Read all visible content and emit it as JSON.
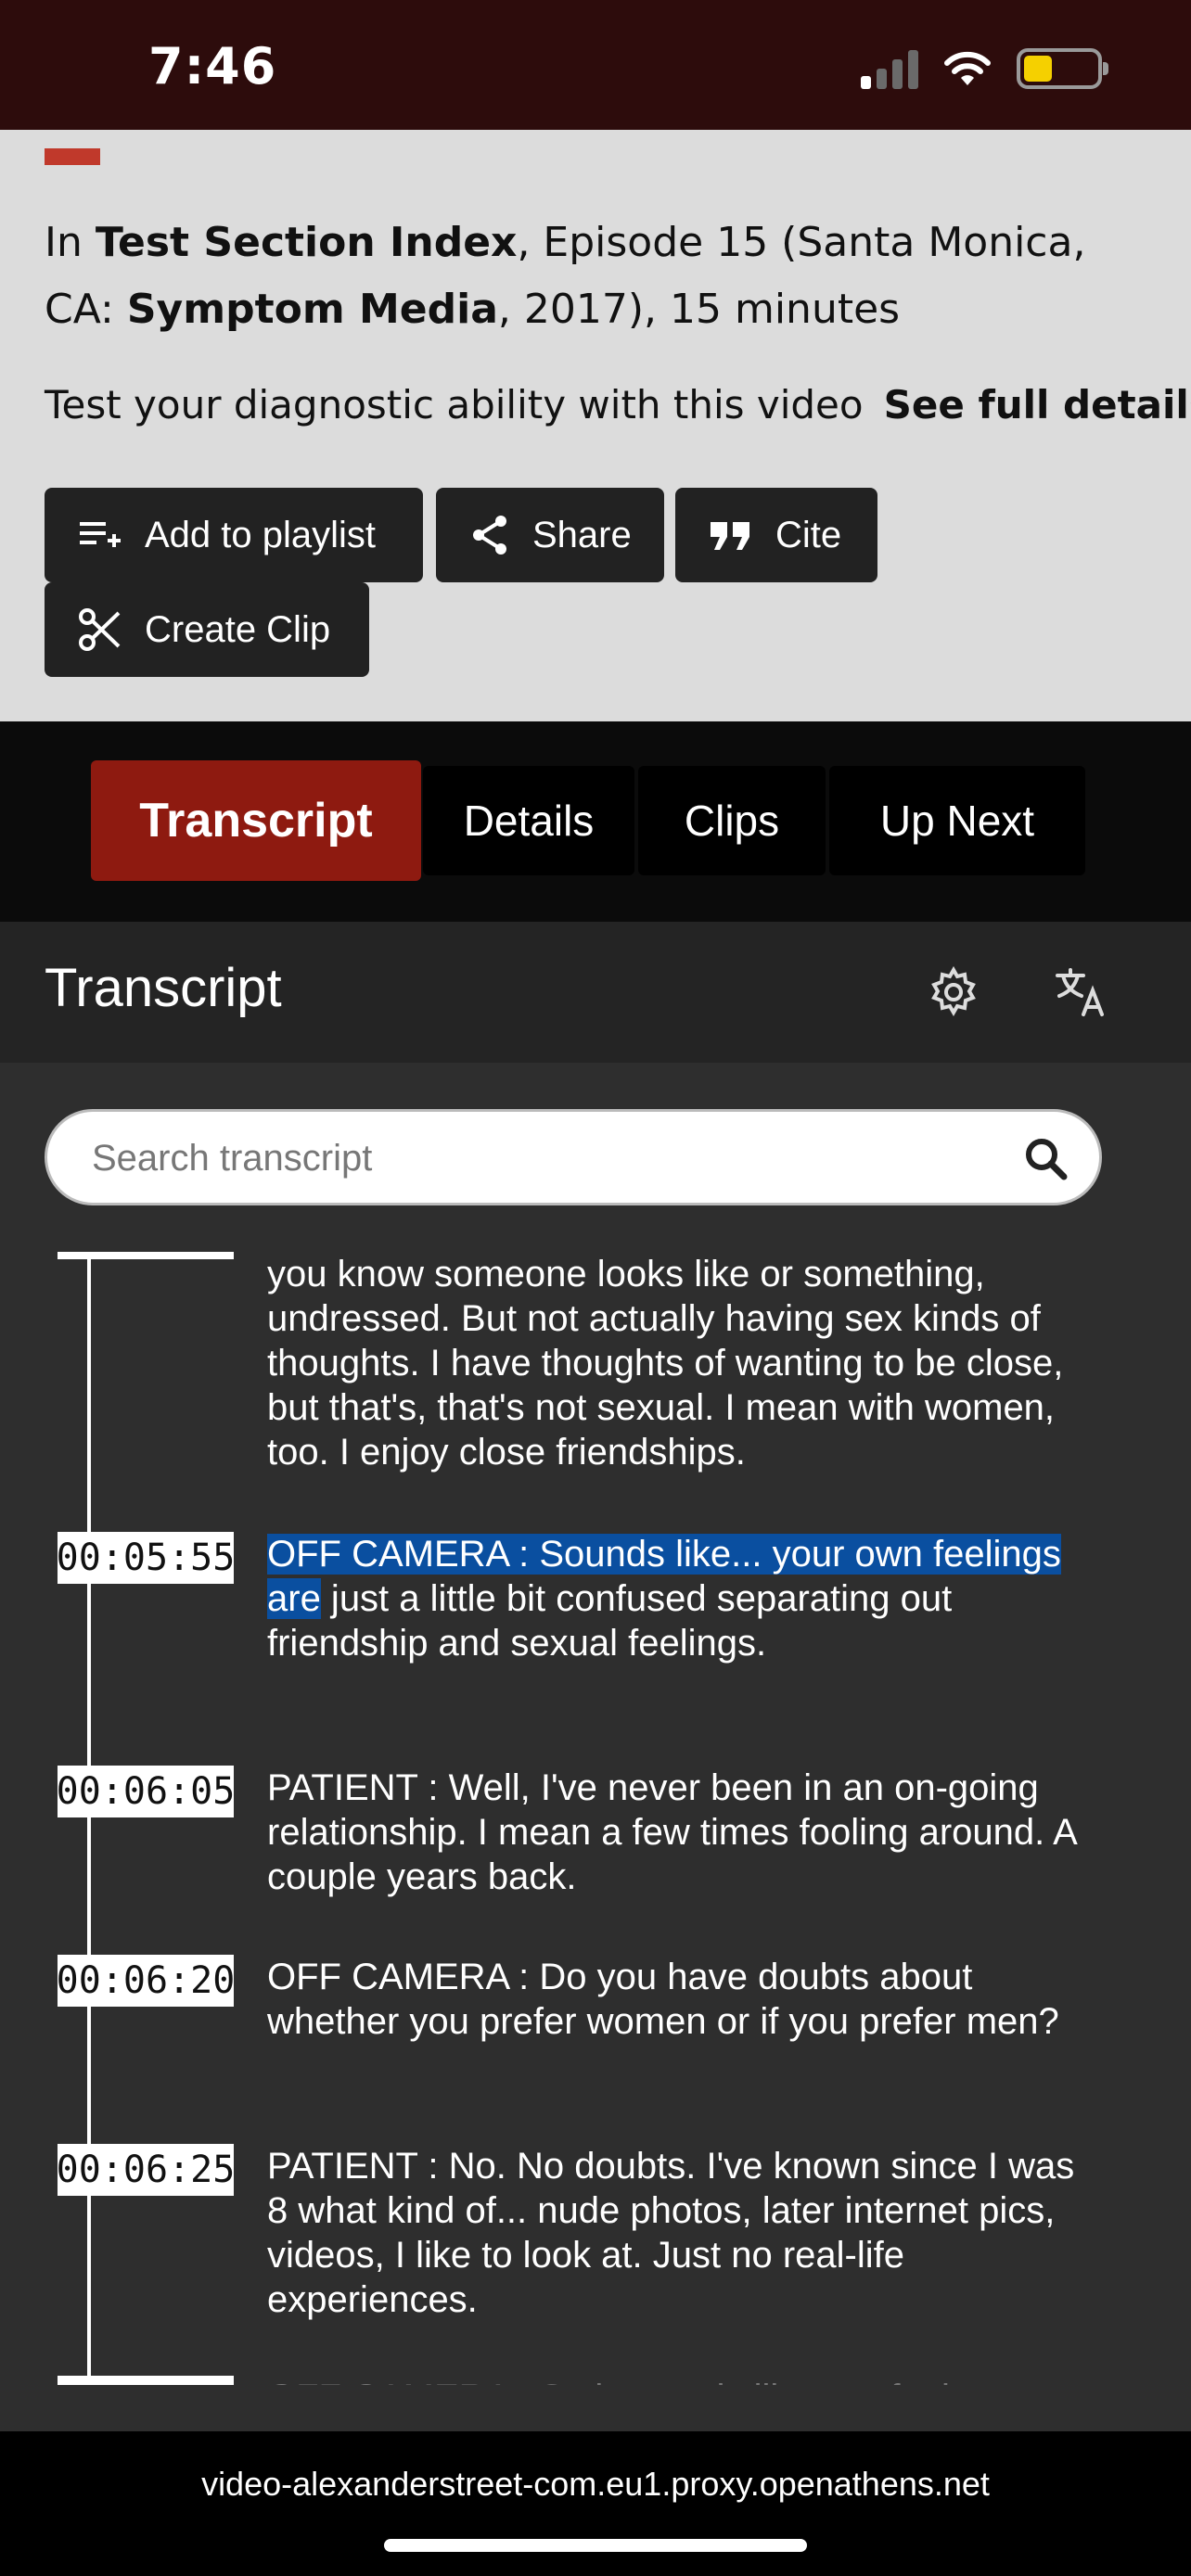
{
  "status_bar": {
    "time": "7:46",
    "icons": [
      "signal-icon",
      "wifi-icon",
      "battery-icon"
    ],
    "battery_color": "#f5d000"
  },
  "info": {
    "citation": {
      "prefix": "In ",
      "series": "Test Section Index",
      "episode": ", Episode 15 (Santa Monica, CA: ",
      "publisher": "Symptom Media",
      "suffix": ", 2017), 15 minutes"
    },
    "description": "Test your diagnostic ability with this video",
    "details_link": "See full details",
    "buttons": {
      "playlist": "Add to playlist",
      "share": "Share",
      "cite": "Cite",
      "clip": "Create Clip"
    }
  },
  "tabs": {
    "transcript": "Transcript",
    "details": "Details",
    "clips": "Clips",
    "up_next": "Up Next",
    "active": "transcript",
    "active_color": "#8e1a10"
  },
  "transcript": {
    "title": "Transcript",
    "search_placeholder": "Search transcript",
    "top_partial": "you know someone looks like or something, undressed. But not actually having sex kinds of thoughts. I have thoughts of wanting to be close, but that's, that's not sexual. I mean with women, too. I enjoy close friendships.",
    "entries": [
      {
        "time": "00:05:55",
        "highlighted": "OFF CAMERA : Sounds like... your own feelings are",
        "text": " just a little bit confused separating out friendship and sexual feelings."
      },
      {
        "time": "00:06:05",
        "text": "PATIENT : Well, I've never been in an on-going relationship. I mean a few times fooling around. A couple years back."
      },
      {
        "time": "00:06:20",
        "text": "OFF CAMERA : Do you have doubts about whether you prefer women or if you prefer men?"
      },
      {
        "time": "00:06:25",
        "text": "PATIENT : No. No doubts. I've known since I was 8 what kind of... nude photos, later internet pics, videos, I like to look at. Just no real-life experiences."
      }
    ],
    "bottom_partial": "OFF CAMERA : So it sounds like you feel",
    "highlight_color": "#0a4fa0"
  },
  "browser": {
    "url": "video-alexanderstreet-com.eu1.proxy.openathens.net"
  }
}
